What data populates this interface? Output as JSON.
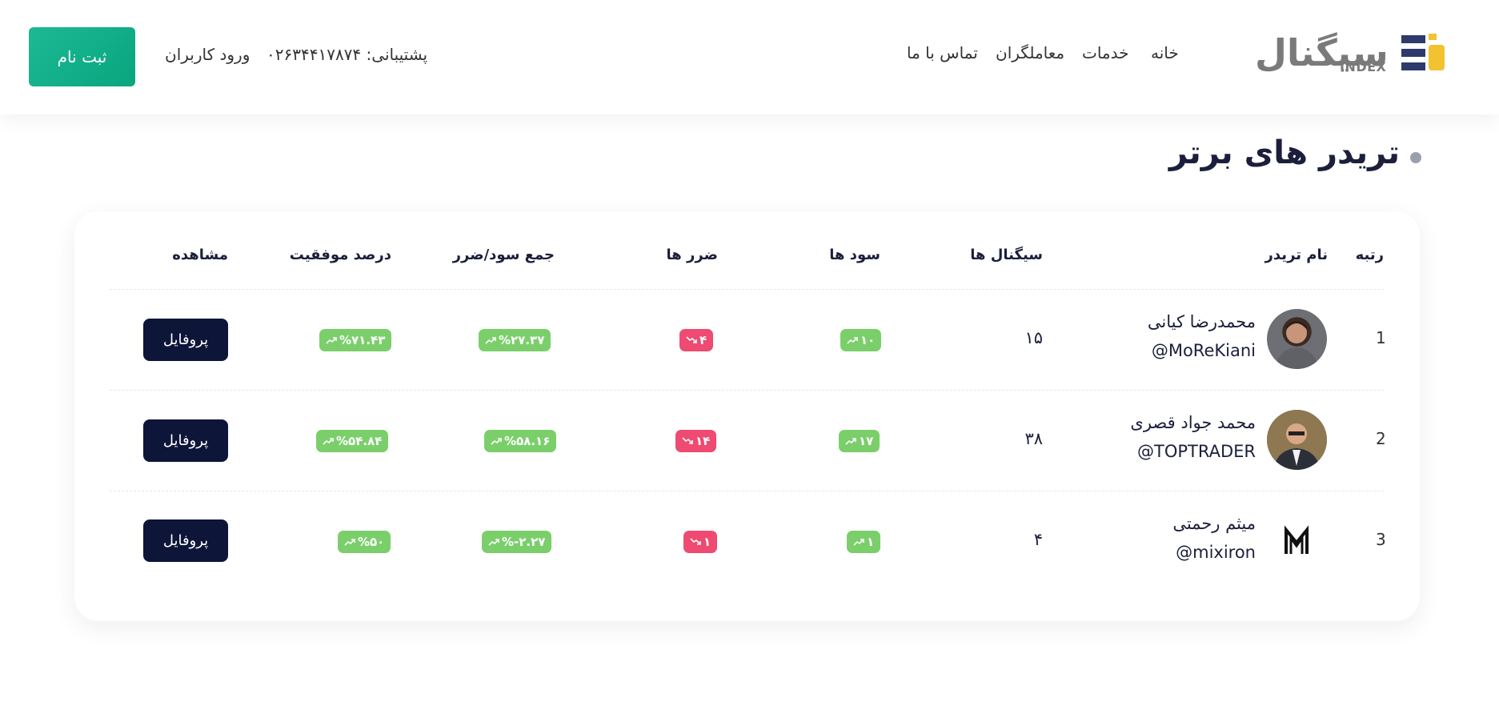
{
  "header": {
    "logo_text": "سیگنال",
    "logo_sub": "INDEX",
    "nav": [
      "خانه",
      "خدمات",
      "معاملگران",
      "تماس با ما"
    ],
    "support": "پشتیبانی: ۰۲۶۳۴۴۱۷۸۷۴",
    "login": "ورود کاربران",
    "signup": "ثبت نام"
  },
  "section": {
    "title": "تریدر های برتر"
  },
  "table": {
    "headers": {
      "rank": "رتبه",
      "trader_name": "نام تریدر",
      "signals": "سیگنال ها",
      "profits": "سود ها",
      "losses": "ضرر ها",
      "total": "جمع سود/ضرر",
      "success": "درصد موفقیت",
      "view": "مشاهده"
    },
    "rows": [
      {
        "rank": "1",
        "name": "محمدرضا کیانی",
        "handle": "@MoReKiani",
        "signals": "۱۵",
        "profits": "۱۰",
        "losses": "۴",
        "total": "%۲۷.۳۷",
        "success": "%۷۱.۴۳",
        "button": "پروفایل"
      },
      {
        "rank": "2",
        "name": "محمد جواد قصری",
        "handle": "@TOPTRADER",
        "signals": "۳۸",
        "profits": "۱۷",
        "losses": "۱۴",
        "total": "%۵۸.۱۶",
        "success": "%۵۴.۸۴",
        "button": "پروفایل"
      },
      {
        "rank": "3",
        "name": "میثم رحمتی",
        "handle": "@mixiron",
        "signals": "۴",
        "profits": "۱",
        "losses": "۱",
        "total": "%-۲.۲۷",
        "success": "%۵۰",
        "button": "پروفایل"
      }
    ]
  },
  "colors": {
    "accent": "#0ab086",
    "dark": "#0d1539",
    "profit": "#7bcf6b",
    "loss": "#ee4a72"
  },
  "icons": {
    "up": "trend-up-icon",
    "down": "trend-down-icon"
  }
}
